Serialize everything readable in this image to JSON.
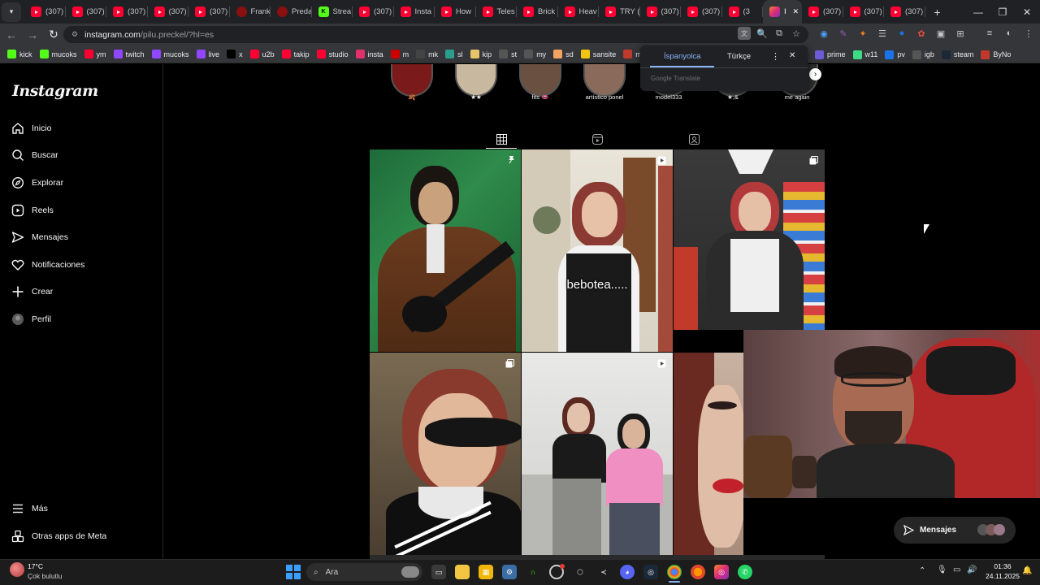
{
  "browser": {
    "tabs": [
      {
        "label": "(307)",
        "icon": "youtube-icon"
      },
      {
        "label": "(307)",
        "icon": "youtube-icon"
      },
      {
        "label": "(307)",
        "icon": "youtube-icon"
      },
      {
        "label": "(307)",
        "icon": "youtube-icon"
      },
      {
        "label": "(307)",
        "icon": "youtube-icon"
      },
      {
        "label": "Frank",
        "icon": "red-circle-icon"
      },
      {
        "label": "Preda",
        "icon": "red-circle-icon"
      },
      {
        "label": "Strea",
        "icon": "kick-icon"
      },
      {
        "label": "(307)",
        "icon": "youtube-icon"
      },
      {
        "label": "Insta",
        "icon": "youtube-icon"
      },
      {
        "label": "How",
        "icon": "youtube-icon"
      },
      {
        "label": "Teles",
        "icon": "youtube-icon"
      },
      {
        "label": "Brick",
        "icon": "youtube-icon"
      },
      {
        "label": "Heav",
        "icon": "youtube-icon"
      },
      {
        "label": "TRY (",
        "icon": "youtube-icon"
      },
      {
        "label": "(307)",
        "icon": "youtube-icon"
      },
      {
        "label": "(307)",
        "icon": "youtube-icon"
      },
      {
        "label": "(3",
        "icon": "youtube-icon"
      },
      {
        "label": "I",
        "icon": "instagram-icon",
        "active": true
      },
      {
        "label": "(307)",
        "icon": "youtube-icon"
      },
      {
        "label": "(307)",
        "icon": "youtube-icon"
      },
      {
        "label": "(307)",
        "icon": "youtube-icon"
      }
    ],
    "url_host": "instagram.com",
    "url_path": "/pilu.preckel/?hl=es",
    "bookmarks": [
      {
        "label": "kick",
        "icon": "kick-icon",
        "color": "#53fc18"
      },
      {
        "label": "mucoks",
        "icon": "kick-icon",
        "color": "#53fc18"
      },
      {
        "label": "ym",
        "icon": "youtube-music-icon",
        "color": "#ff0033"
      },
      {
        "label": "twitch",
        "icon": "twitch-icon",
        "color": "#9146ff"
      },
      {
        "label": "mucoks",
        "icon": "twitch-icon",
        "color": "#9146ff"
      },
      {
        "label": "live",
        "icon": "twitch-icon",
        "color": "#9146ff"
      },
      {
        "label": "x",
        "icon": "x-icon",
        "color": "#000000"
      },
      {
        "label": "u2b",
        "icon": "youtube-icon",
        "color": "#ff0033"
      },
      {
        "label": "takip",
        "icon": "youtube-icon",
        "color": "#ff0033"
      },
      {
        "label": "studio",
        "icon": "youtube-icon",
        "color": "#ff0033"
      },
      {
        "label": "insta",
        "icon": "instagram-icon",
        "color": "#e1306c"
      },
      {
        "label": "m",
        "icon": "red-logo-icon",
        "color": "#c00"
      },
      {
        "label": "mk",
        "icon": "mk-icon",
        "color": "#444"
      },
      {
        "label": "sl",
        "icon": "sl-icon",
        "color": "#2a9d8f"
      },
      {
        "label": "kip",
        "icon": "kip-icon",
        "color": "#e9c46a"
      },
      {
        "label": "st",
        "icon": "github-icon",
        "color": "#555"
      },
      {
        "label": "my",
        "icon": "my-icon",
        "color": "#555"
      },
      {
        "label": "sd",
        "icon": "s-icon",
        "color": "#f4a261"
      },
      {
        "label": "sansite",
        "icon": "s-icon",
        "color": "#f1c40f"
      },
      {
        "label": "my",
        "icon": "red-logo-icon",
        "color": "#c0392b"
      }
    ],
    "bookmarks_right": [
      {
        "label": "prime",
        "icon": "prime-icon",
        "color": "#6b5bd6"
      },
      {
        "label": "w11",
        "icon": "power-icon",
        "color": "#3ddc84"
      },
      {
        "label": "pv",
        "icon": "play-icon",
        "color": "#1a73e8"
      },
      {
        "label": "igb",
        "icon": "igb-icon",
        "color": "#555"
      },
      {
        "label": "steam",
        "icon": "steam-icon",
        "color": "#1b2838"
      },
      {
        "label": "ByNo",
        "icon": "bynoir-icon",
        "color": "#c0392b"
      }
    ]
  },
  "translate": {
    "lang_from": "İspanyolca",
    "lang_to": "Türkçe",
    "brand": "Google Translate"
  },
  "instagram": {
    "logo": "Instagram",
    "nav": [
      {
        "label": "Inicio",
        "icon": "home-icon"
      },
      {
        "label": "Buscar",
        "icon": "search-icon"
      },
      {
        "label": "Explorar",
        "icon": "compass-icon"
      },
      {
        "label": "Reels",
        "icon": "reels-icon"
      },
      {
        "label": "Mensajes",
        "icon": "send-icon"
      },
      {
        "label": "Notificaciones",
        "icon": "heart-icon"
      },
      {
        "label": "Crear",
        "icon": "plus-icon"
      },
      {
        "label": "Perfil",
        "icon": "avatar-icon"
      }
    ],
    "nav_bottom": [
      {
        "label": "Más",
        "icon": "menu-icon"
      },
      {
        "label": "Otras apps de Meta",
        "icon": "meta-apps-icon"
      }
    ],
    "highlights": [
      {
        "label": "🍂"
      },
      {
        "label": "★★"
      },
      {
        "label": "fits 👄"
      },
      {
        "label": "artístico ponel"
      },
      {
        "label": "model333"
      },
      {
        "label": "★;&"
      },
      {
        "label": "me again"
      }
    ],
    "post_caption": "bebotea.....",
    "messages_label": "Mensajes"
  },
  "taskbar": {
    "weather_temp": "17°C",
    "weather_desc": "Çok bulutlu",
    "search_label": "Ara",
    "time": "01:36",
    "date": "24.11.2025"
  }
}
